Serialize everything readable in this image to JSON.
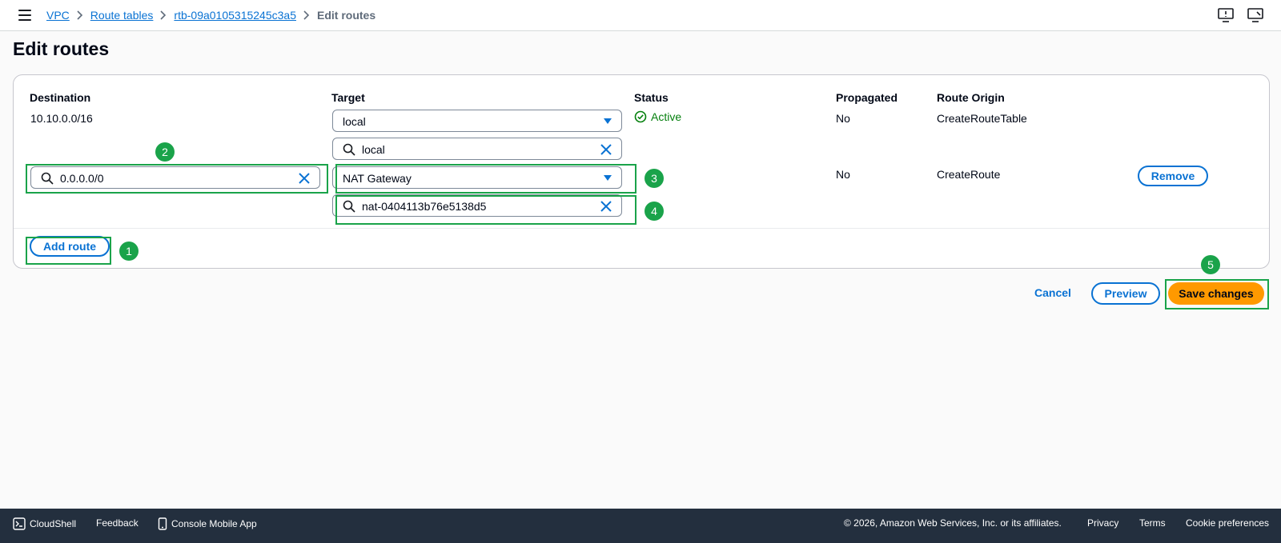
{
  "breadcrumb": {
    "items": [
      "VPC",
      "Route tables",
      "rtb-09a0105315245c3a5"
    ],
    "current": "Edit routes"
  },
  "page_title": "Edit routes",
  "columns": {
    "destination": "Destination",
    "target": "Target",
    "status": "Status",
    "propagated": "Propagated",
    "route_origin": "Route Origin"
  },
  "routes": [
    {
      "destination": "10.10.0.0/16",
      "target_type": "local",
      "target_search": "local",
      "status": "Active",
      "propagated": "No",
      "route_origin": "CreateRouteTable"
    },
    {
      "destination": "0.0.0.0/0",
      "target_type": "NAT Gateway",
      "target_search": "nat-0404113b76e5138d5",
      "propagated": "No",
      "route_origin": "CreateRoute",
      "remove_label": "Remove"
    }
  ],
  "add_route_label": "Add route",
  "actions": {
    "cancel": "Cancel",
    "preview": "Preview",
    "save": "Save changes"
  },
  "annotations": [
    "1",
    "2",
    "3",
    "4",
    "5"
  ],
  "footer": {
    "cloudshell": "CloudShell",
    "feedback": "Feedback",
    "mobile_app": "Console Mobile App",
    "copyright": "© 2026, Amazon Web Services, Inc. or its affiliates.",
    "privacy": "Privacy",
    "terms": "Terms",
    "cookie": "Cookie preferences"
  },
  "colors": {
    "link": "#0972d3",
    "primary_button": "#ff9900",
    "status_active": "#037f0c",
    "annotation": "#1aa34a",
    "footer_bg": "#232f3e"
  }
}
